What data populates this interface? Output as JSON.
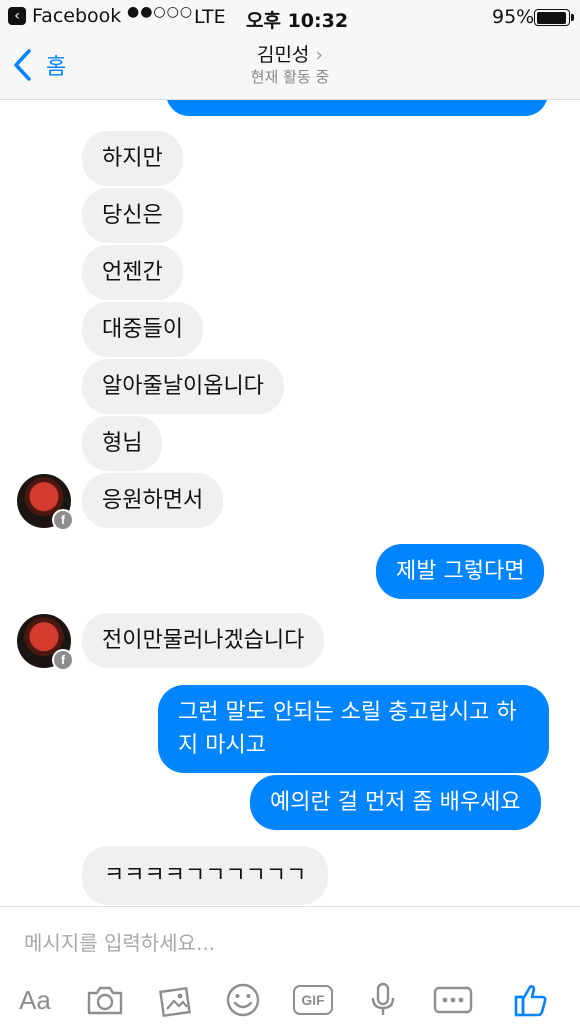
{
  "status_bar": {
    "back_app": "Facebook",
    "signal": "●●○○○",
    "carrier": "LTE",
    "time": "오후 10:32",
    "battery": "95%",
    "battery_level": 0.95
  },
  "header": {
    "back_label": "홈",
    "contact_name": "김민성",
    "status": "현재 활동 중"
  },
  "messages": [
    {
      "side": "in",
      "text": "하지만"
    },
    {
      "side": "in",
      "text": "당신은"
    },
    {
      "side": "in",
      "text": "언젠간"
    },
    {
      "side": "in",
      "text": "대중들이"
    },
    {
      "side": "in",
      "text": "알아줄날이옵니다"
    },
    {
      "side": "in",
      "text": "형님"
    },
    {
      "side": "in",
      "text": "응원하면서"
    },
    {
      "side": "out",
      "text": "제발 그렇다면"
    },
    {
      "side": "in",
      "text": "전이만물러나겠습니다"
    },
    {
      "side": "out",
      "text": "그런 말도 안되는 소릴 충고랍시고 하"
    },
    {
      "side": "out",
      "text": "지 마시고"
    },
    {
      "side": "out",
      "text": "예의란 걸 먼저 좀 배우세요"
    },
    {
      "side": "in",
      "text": "ㅋㅋㅋㅋㄱㄱㄱㄱㄱㄱ"
    }
  ],
  "composer": {
    "placeholder": "메시지를 입력하세요...",
    "text_tool": "Aa",
    "gif_label": "GIF"
  },
  "colors": {
    "accent": "#0084ff",
    "incoming_bubble": "#f1f0f0"
  },
  "icons": [
    "back-chevron-icon",
    "camera-icon",
    "gallery-icon",
    "emoji-icon",
    "gif-icon",
    "microphone-icon",
    "more-icon",
    "like-icon"
  ]
}
